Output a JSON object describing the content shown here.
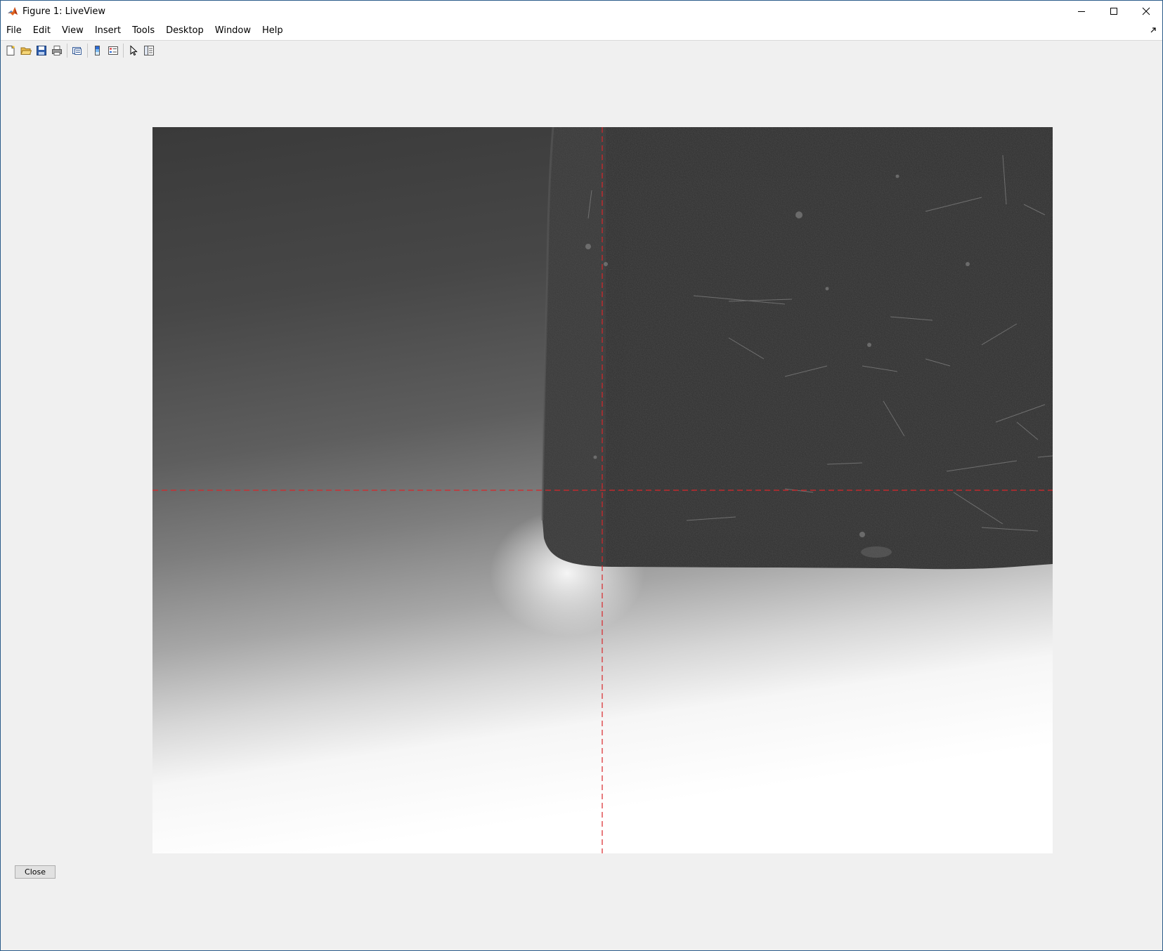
{
  "window": {
    "title": "Figure 1: LiveView",
    "controls": [
      "minimize-icon",
      "maximize-icon",
      "close-icon"
    ]
  },
  "menubar": {
    "items": [
      {
        "label": "File"
      },
      {
        "label": "Edit"
      },
      {
        "label": "View"
      },
      {
        "label": "Insert"
      },
      {
        "label": "Tools"
      },
      {
        "label": "Desktop"
      },
      {
        "label": "Window"
      },
      {
        "label": "Help"
      }
    ]
  },
  "toolbar": {
    "buttons": [
      "new-figure-icon",
      "open-file-icon",
      "save-icon",
      "print-icon",
      "link-plot-icon",
      "insert-colorbar-icon",
      "insert-legend-icon",
      "edit-plot-icon",
      "property-inspector-icon"
    ]
  },
  "figure": {
    "crosshair_color": "#d9262a",
    "crosshair_style": "dashed"
  },
  "footer": {
    "close_label": "Close"
  }
}
